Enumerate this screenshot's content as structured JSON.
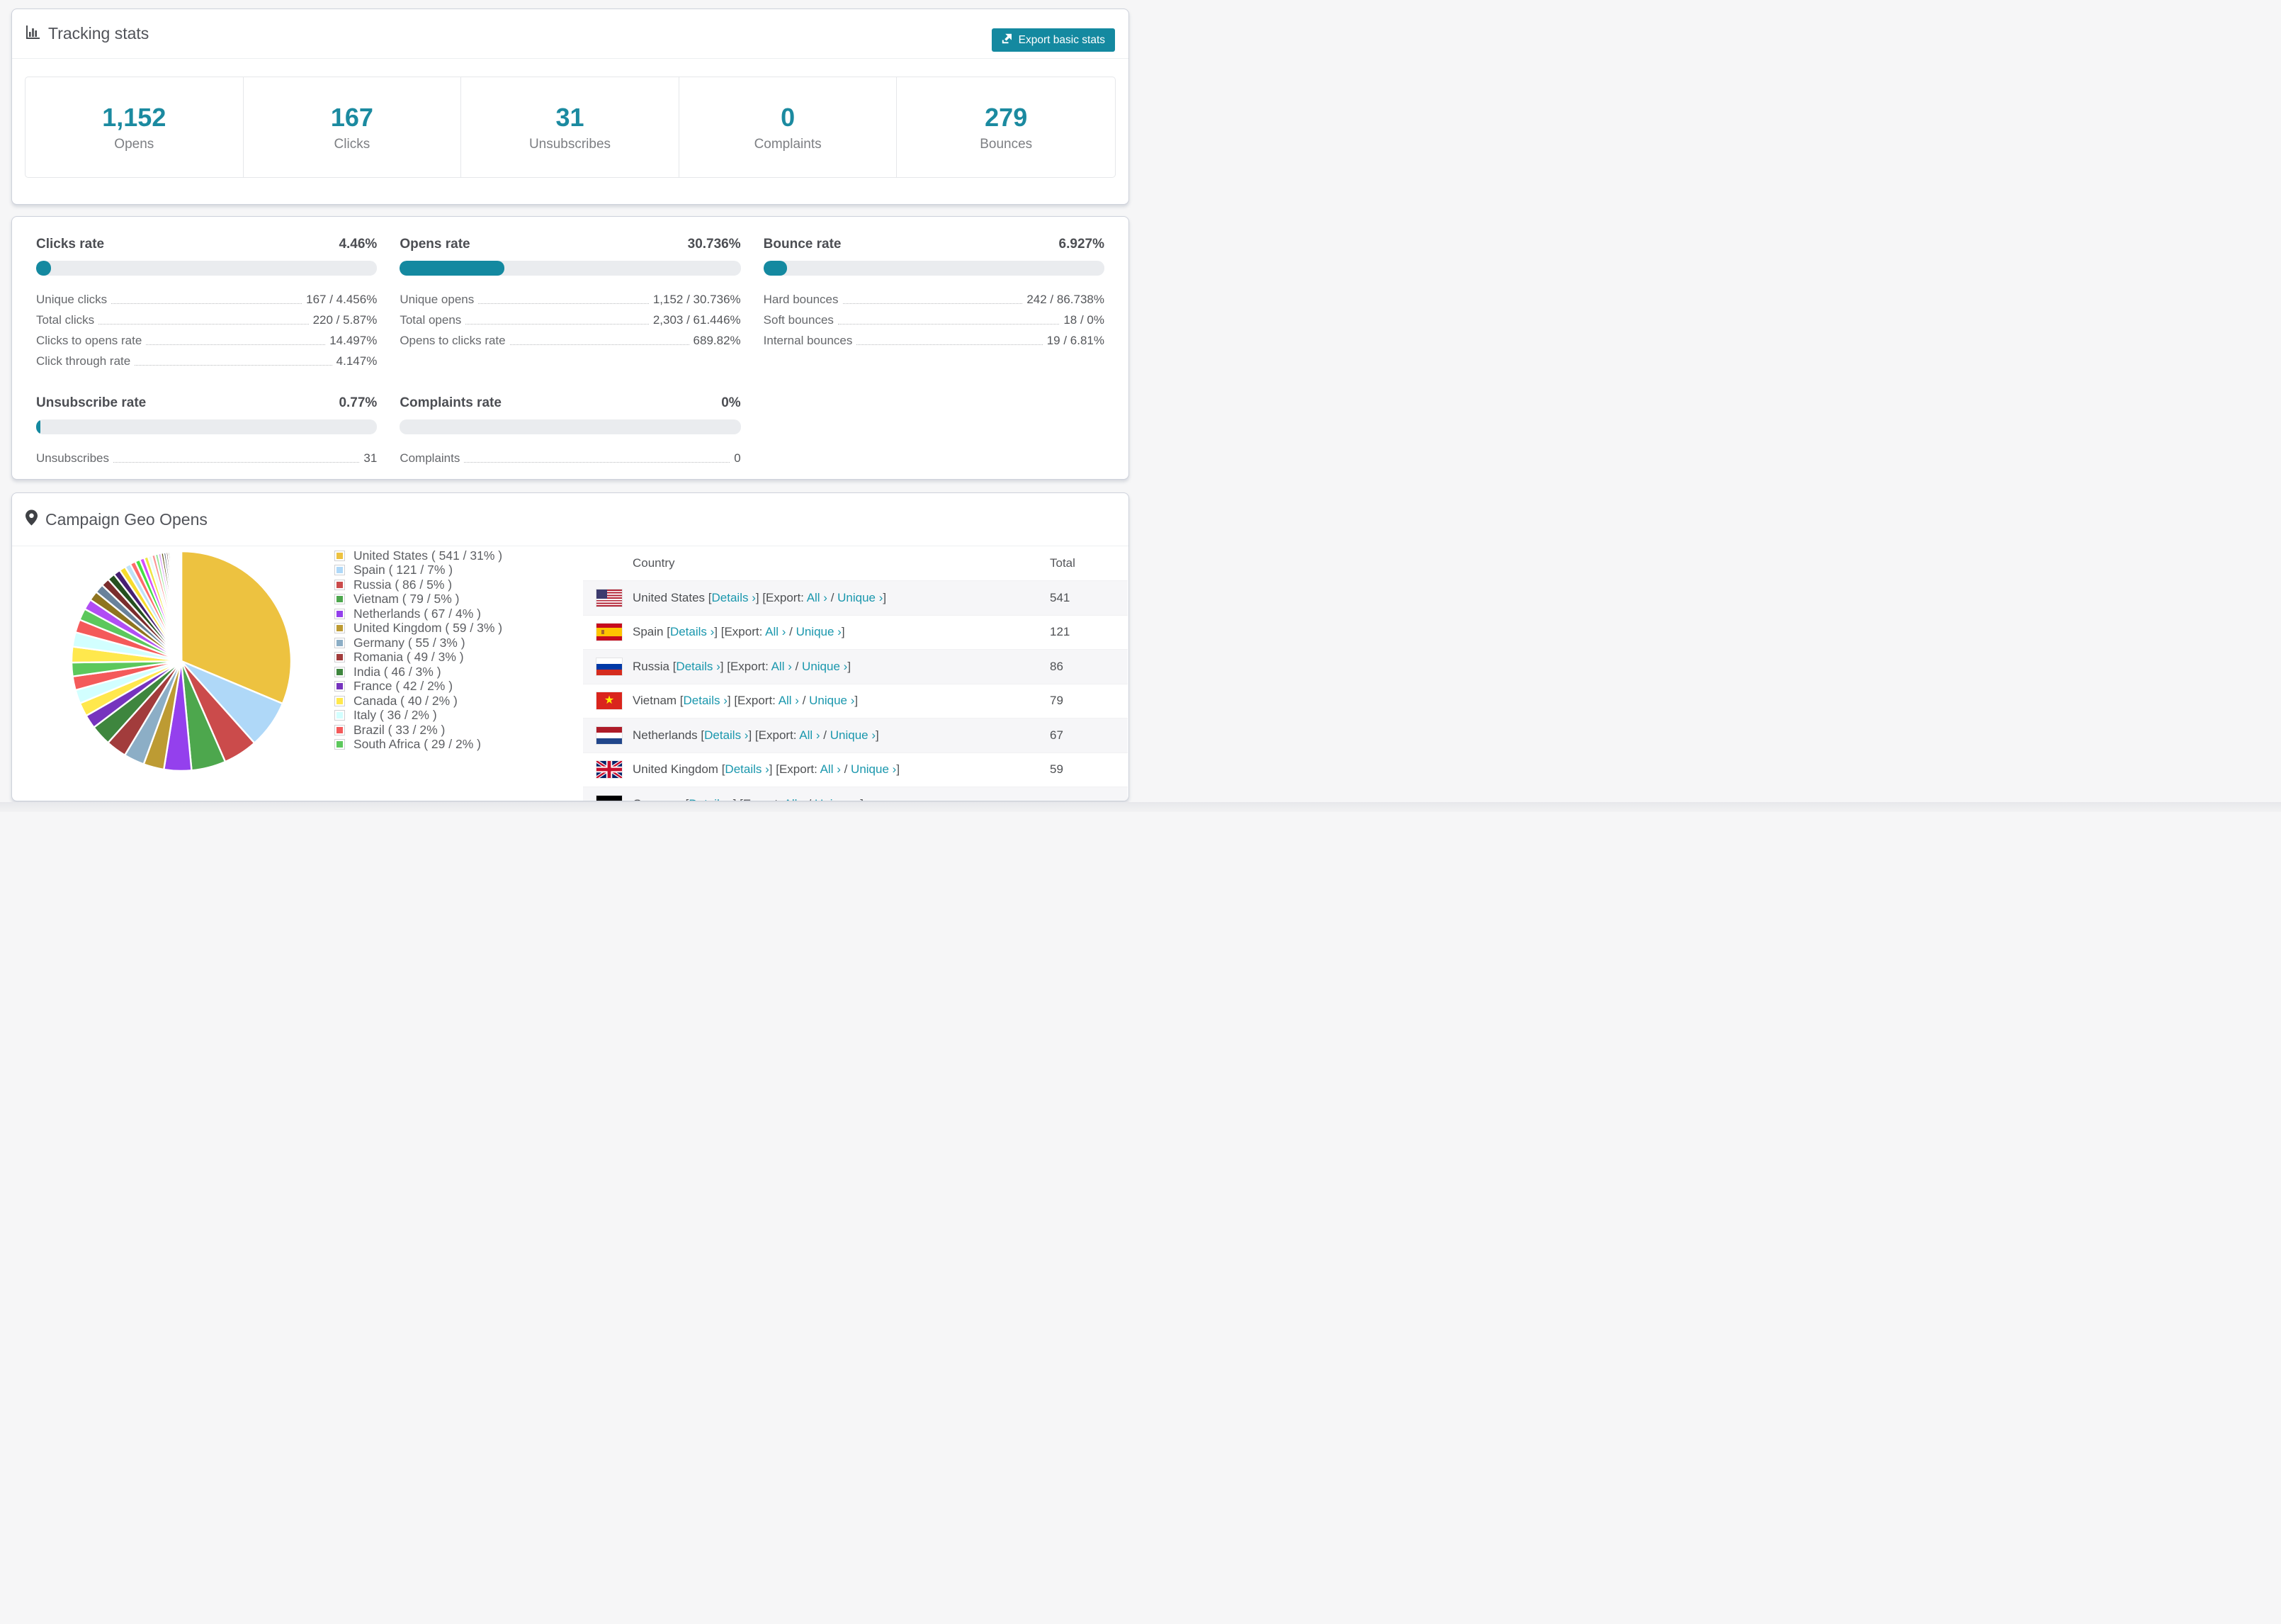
{
  "colors": {
    "accent": "#1489a0",
    "stat_number": "#1b8aa0",
    "link": "#1a97ad",
    "bar_track": "#eaecef"
  },
  "tracking": {
    "title": "Tracking stats",
    "export_label": "Export basic stats",
    "summary": [
      {
        "value": "1,152",
        "label": "Opens"
      },
      {
        "value": "167",
        "label": "Clicks"
      },
      {
        "value": "31",
        "label": "Unsubscribes"
      },
      {
        "value": "0",
        "label": "Complaints"
      },
      {
        "value": "279",
        "label": "Bounces"
      }
    ]
  },
  "rate_sections": [
    {
      "title": "Clicks rate",
      "rate": "4.46%",
      "percent": 4.46,
      "rows": [
        {
          "label": "Unique clicks",
          "value": "167 / 4.456%"
        },
        {
          "label": "Total clicks",
          "value": "220 / 5.87%"
        },
        {
          "label": "Clicks to opens rate",
          "value": "14.497%"
        },
        {
          "label": "Click through rate",
          "value": "4.147%"
        }
      ]
    },
    {
      "title": "Opens rate",
      "rate": "30.736%",
      "percent": 30.736,
      "rows": [
        {
          "label": "Unique opens",
          "value": "1,152 / 30.736%"
        },
        {
          "label": "Total opens",
          "value": "2,303 / 61.446%"
        },
        {
          "label": "Opens to clicks rate",
          "value": "689.82%"
        }
      ]
    },
    {
      "title": "Bounce rate",
      "rate": "6.927%",
      "percent": 6.927,
      "rows": [
        {
          "label": "Hard bounces",
          "value": "242 / 86.738%"
        },
        {
          "label": "Soft bounces",
          "value": "18 / 0%"
        },
        {
          "label": "Internal bounces",
          "value": "19 / 6.81%"
        }
      ]
    },
    {
      "title": "Unsubscribe rate",
      "rate": "0.77%",
      "percent": 0.77,
      "rows": [
        {
          "label": "Unsubscribes",
          "value": "31"
        }
      ]
    },
    {
      "title": "Complaints rate",
      "rate": "0%",
      "percent": 0,
      "rows": [
        {
          "label": "Complaints",
          "value": "0"
        }
      ]
    }
  ],
  "geo": {
    "title": "Campaign Geo Opens",
    "table_headers": {
      "country": "Country",
      "total": "Total"
    },
    "links": {
      "bracket_open": "[",
      "details": "Details ›",
      "bracket_close": "]",
      "export_open": "[Export:",
      "all": "All ›",
      "slash": "/",
      "unique": "Unique ›",
      "export_close": "]"
    },
    "rows": [
      {
        "country": "United States",
        "flag": "us",
        "total": "541"
      },
      {
        "country": "Spain",
        "flag": "es",
        "total": "121"
      },
      {
        "country": "Russia",
        "flag": "ru",
        "total": "86"
      },
      {
        "country": "Vietnam",
        "flag": "vn",
        "total": "79"
      },
      {
        "country": "Netherlands",
        "flag": "nl",
        "total": "67"
      },
      {
        "country": "United Kingdom",
        "flag": "gb",
        "total": "59"
      },
      {
        "country": "Germany",
        "flag": "de",
        "total": ""
      }
    ]
  },
  "chart_data": {
    "type": "pie",
    "title": "Campaign Geo Opens",
    "unit": "opens",
    "legend_position": "right",
    "slices": [
      {
        "name": "United States",
        "value": 541,
        "pct": 31,
        "color": "#edc240"
      },
      {
        "name": "Spain",
        "value": 121,
        "pct": 7,
        "color": "#afd8f8"
      },
      {
        "name": "Russia",
        "value": 86,
        "pct": 5,
        "color": "#cb4b4b"
      },
      {
        "name": "Vietnam",
        "value": 79,
        "pct": 5,
        "color": "#4da74d"
      },
      {
        "name": "Netherlands",
        "value": 67,
        "pct": 4,
        "color": "#9440ed"
      },
      {
        "name": "United Kingdom",
        "value": 59,
        "pct": 3,
        "color": "#bd9b33"
      },
      {
        "name": "Germany",
        "value": 55,
        "pct": 3,
        "color": "#8caec6"
      },
      {
        "name": "Romania",
        "value": 49,
        "pct": 3,
        "color": "#a23c3c"
      },
      {
        "name": "India",
        "value": 46,
        "pct": 3,
        "color": "#3e863e"
      },
      {
        "name": "France",
        "value": 42,
        "pct": 2,
        "color": "#7633be"
      },
      {
        "name": "Canada",
        "value": 40,
        "pct": 2,
        "color": "#ffe84d"
      },
      {
        "name": "Italy",
        "value": 36,
        "pct": 2,
        "color": "#d2ffff"
      },
      {
        "name": "Brazil",
        "value": 33,
        "pct": 2,
        "color": "#f45a5a"
      },
      {
        "name": "South Africa",
        "value": 29,
        "pct": 2,
        "color": "#5cc85c"
      }
    ],
    "others": {
      "note": "remaining small countries rendered as thin slices",
      "values": [
        2.3,
        2.1,
        1.9,
        1.7,
        1.55,
        1.4,
        1.3,
        1.2,
        1.1,
        1.0,
        0.92,
        0.85,
        0.78,
        0.72,
        0.66,
        0.6,
        0.55,
        0.5,
        0.46,
        0.42,
        0.38,
        0.34,
        0.3,
        0.27,
        0.24,
        0.21,
        0.18,
        0.16,
        0.14,
        0.12,
        0.1,
        0.09,
        0.08,
        0.07,
        0.06,
        0.05,
        0.045,
        0.04,
        0.035,
        0.03
      ],
      "colors": [
        "#ffe84d",
        "#d2ffff",
        "#f45a5a",
        "#5cc85c",
        "#b14df4",
        "#8e741f",
        "#69829b",
        "#7a2d2d",
        "#25501f",
        "#471f72",
        "#f7dc2e",
        "#bfe2f8",
        "#ff6b6b",
        "#44e044",
        "#d24dff",
        "#efe543",
        "#e8fafa",
        "#fa9494",
        "#98e698",
        "#dca3f9",
        "#5a4d10",
        "#46576b",
        "#521e1e",
        "#1e431e",
        "#3b1660",
        "#ffd700",
        "#9ecae8",
        "#e83a3a",
        "#2eb847",
        "#a64df0",
        "#8f8f1a",
        "#33506b",
        "#6b1a1a",
        "#104010",
        "#2e1050",
        "#f5e97a",
        "#b5dcf2",
        "#e05252",
        "#55d055",
        "#aa55ff"
      ]
    }
  }
}
